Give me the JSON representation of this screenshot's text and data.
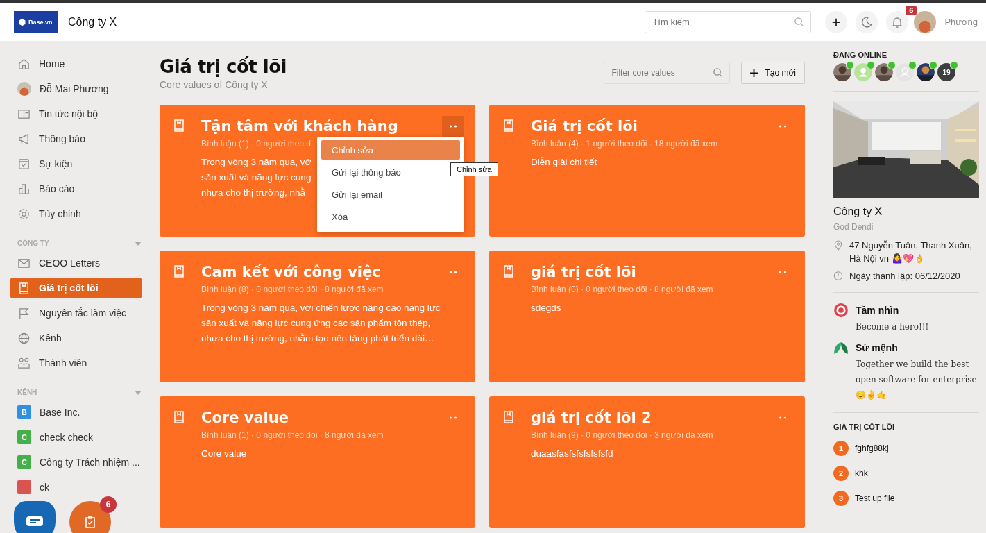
{
  "header": {
    "logo_text": "Base.vn",
    "company": "Công ty X",
    "search": {
      "placeholder": "Tìm kiếm"
    },
    "notification_count": "6",
    "user_name": "Phương"
  },
  "sidebar": {
    "items": [
      {
        "label": "Home",
        "kind": "icon",
        "selected": false
      },
      {
        "label": "Đỗ Mai Phương",
        "kind": "avatar",
        "selected": false
      },
      {
        "label": "Tin tức nội bộ",
        "kind": "icon",
        "selected": false
      },
      {
        "label": "Thông báo",
        "kind": "icon",
        "selected": false
      },
      {
        "label": "Sự kiện",
        "kind": "icon",
        "selected": false
      },
      {
        "label": "Báo cáo",
        "kind": "icon",
        "selected": false
      },
      {
        "label": "Tùy chỉnh",
        "kind": "icon",
        "selected": false
      }
    ],
    "sections": [
      {
        "title": "CÔNG TY",
        "items": [
          {
            "label": "CEOO Letters",
            "kind": "icon",
            "selected": false
          },
          {
            "label": "Giá trị cốt lõi",
            "kind": "icon",
            "selected": true
          },
          {
            "label": "Nguyên tắc làm việc",
            "kind": "icon",
            "selected": false
          },
          {
            "label": "Kênh",
            "kind": "icon",
            "selected": false
          },
          {
            "label": "Thành viên",
            "kind": "icon",
            "selected": false
          }
        ]
      },
      {
        "title": "KÊNH",
        "items": [
          {
            "label": "Base Inc.",
            "kind": "letter",
            "letter": "B",
            "color": "#2f8fe0",
            "selected": false
          },
          {
            "label": "check check",
            "kind": "letter",
            "letter": "C",
            "color": "#43b04a",
            "selected": false
          },
          {
            "label": "Công ty Trách nhiệm ...",
            "kind": "letter",
            "letter": "C",
            "color": "#43b04a",
            "selected": false
          },
          {
            "label": "ck",
            "kind": "letter",
            "color": "#d9534f",
            "selected": false
          }
        ]
      }
    ]
  },
  "floating": {
    "task_count": "6"
  },
  "page": {
    "title": "Giá trị cốt lõi",
    "subtitle": "Core values of Công ty X",
    "filter": {
      "placeholder": "Filter core values"
    },
    "create_button": "Tạo mới"
  },
  "cards": [
    {
      "title": "Tận tâm với khách hàng",
      "meta": "Bình luận (1) · 0 người theo d",
      "lines": [
        "Trong vòng 3 năm qua, vớ",
        "sản xuất và năng lực cung",
        "nhựa cho thị trường, nhằ"
      ],
      "menu_open": true
    },
    {
      "title": "Giá trị cốt lõi",
      "meta": "Bình luận (4) · 1 người theo dõi · 18 người đã xem",
      "lines": [
        "Diễn giải chi tiết"
      ],
      "menu_open": false
    },
    {
      "title": "Cam kết với công việc",
      "meta": "Bình luận (8) · 0 người theo dõi · 8 người đã xem",
      "lines": [
        "Trong vòng 3 năm qua, với chiến lược nâng cao năng lực",
        "sản xuất và năng lực cung ứng các sản phẩm tôn thép,",
        "nhựa cho thị trường, nhằm tạo nền tảng phát triển dài…"
      ],
      "menu_open": false
    },
    {
      "title": "giá trị cốt lõi",
      "meta": "Bình luận (0) · 0 người theo dõi · 8 người đã xem",
      "lines": [
        "sdegds"
      ],
      "menu_open": false
    },
    {
      "title": "Core value",
      "meta": "Bình luận (1) · 0 người theo dõi · 8 người đã xem",
      "lines": [
        "Core value"
      ],
      "menu_open": false
    },
    {
      "title": "giá trị cốt lõi 2",
      "meta": "Bình luận (9) · 0 người theo dõi · 3 người đã xem",
      "lines": [
        "duaasfasfsfsfsfsfsfd"
      ],
      "menu_open": false
    }
  ],
  "card_menu": {
    "items": [
      {
        "label": "Chỉnh sửa",
        "selected": true
      },
      {
        "label": "Gửi lại thông báo",
        "selected": false
      },
      {
        "label": "Gửi lại email",
        "selected": false
      },
      {
        "label": "Xóa",
        "selected": false
      }
    ],
    "tooltip": "Chỉnh sửa"
  },
  "right_panel": {
    "online_title": "ĐANG ONLINE",
    "online_users": [
      {
        "kind": "picture"
      },
      {
        "kind": "default"
      },
      {
        "kind": "picture"
      },
      {
        "kind": "blank"
      },
      {
        "kind": "picture"
      },
      {
        "kind": "count",
        "count": "19"
      }
    ],
    "company": {
      "name": "Công ty X",
      "owner": "God Dendi",
      "address": "47 Nguyễn Tuân, Thanh Xuân, Hà Nội vn 🤷‍♀️💖👌",
      "founded": "Ngày thành lập: 06/12/2020"
    },
    "vision": {
      "title": "Tầm nhìn",
      "text": "Become a hero!!!"
    },
    "mission": {
      "title": "Sứ mệnh",
      "text": "Together we build the best open software for enterprise 😊✌🤙"
    },
    "core_values_title": "GIÁ TRỊ CỐT LÕI",
    "core_values": [
      {
        "number": "1",
        "label": "fghfg88kj"
      },
      {
        "number": "2",
        "label": "khk"
      },
      {
        "number": "3",
        "label": "Test up file"
      }
    ]
  }
}
